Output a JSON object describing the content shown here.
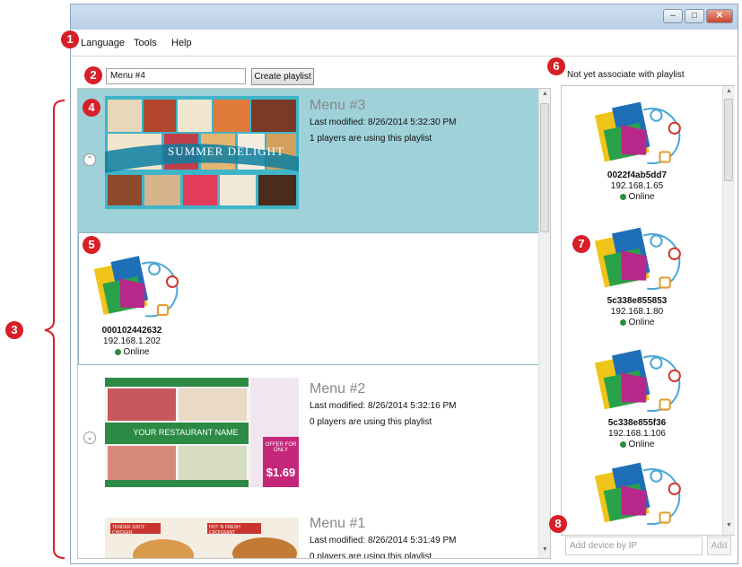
{
  "menu": {
    "language": "Language",
    "tools": "Tools",
    "help": "Help"
  },
  "window_controls": {
    "minimize": "–",
    "maximize": "□",
    "close": "✕"
  },
  "callouts": [
    "1",
    "2",
    "3",
    "4",
    "5",
    "6",
    "7",
    "8"
  ],
  "toolbar": {
    "playlist_name_value": "Menu #4",
    "create_label": "Create playlist"
  },
  "playlists": [
    {
      "title": "Menu #3",
      "modified": "Last modified: 8/26/2014 5:32:30 PM",
      "players": "1 players are using this playlist",
      "thumb_text": "SUMMER DELIGHT"
    },
    {
      "title": "Menu #2",
      "modified": "Last modified: 8/26/2014 5:32:16 PM",
      "players": "0 players are using this playlist",
      "thumb_text": "YOUR RESTAURANT NAME",
      "thumb_offer": "OFFER FOR ONLY",
      "thumb_price": "$1.69"
    },
    {
      "title": "Menu #1",
      "modified": "Last modified: 8/26/2014 5:31:49 PM",
      "players": "0 players are using this playlist",
      "thumb_label_a": "TENDER JUICY CHICKEN",
      "thumb_label_b": "HOT 'N FRESH CROISSANT"
    }
  ],
  "assigned_device": {
    "id": "000102442632",
    "ip": "192.168.1.202",
    "status": "Online"
  },
  "unassigned": {
    "heading": "Not yet associate with playlist",
    "devices": [
      {
        "id": "0022f4ab5dd7",
        "ip": "192.168.1.65",
        "status": "Online"
      },
      {
        "id": "5c338e855853",
        "ip": "192.168.1.80",
        "status": "Online"
      },
      {
        "id": "5c338e855f36",
        "ip": "192.168.1.106",
        "status": "Online"
      }
    ],
    "add_placeholder": "Add device by IP",
    "add_label": "Add"
  },
  "colors": {
    "selected_row": "#9fd1d9",
    "callout": "#d61f27",
    "online": "#2e8b3a"
  }
}
